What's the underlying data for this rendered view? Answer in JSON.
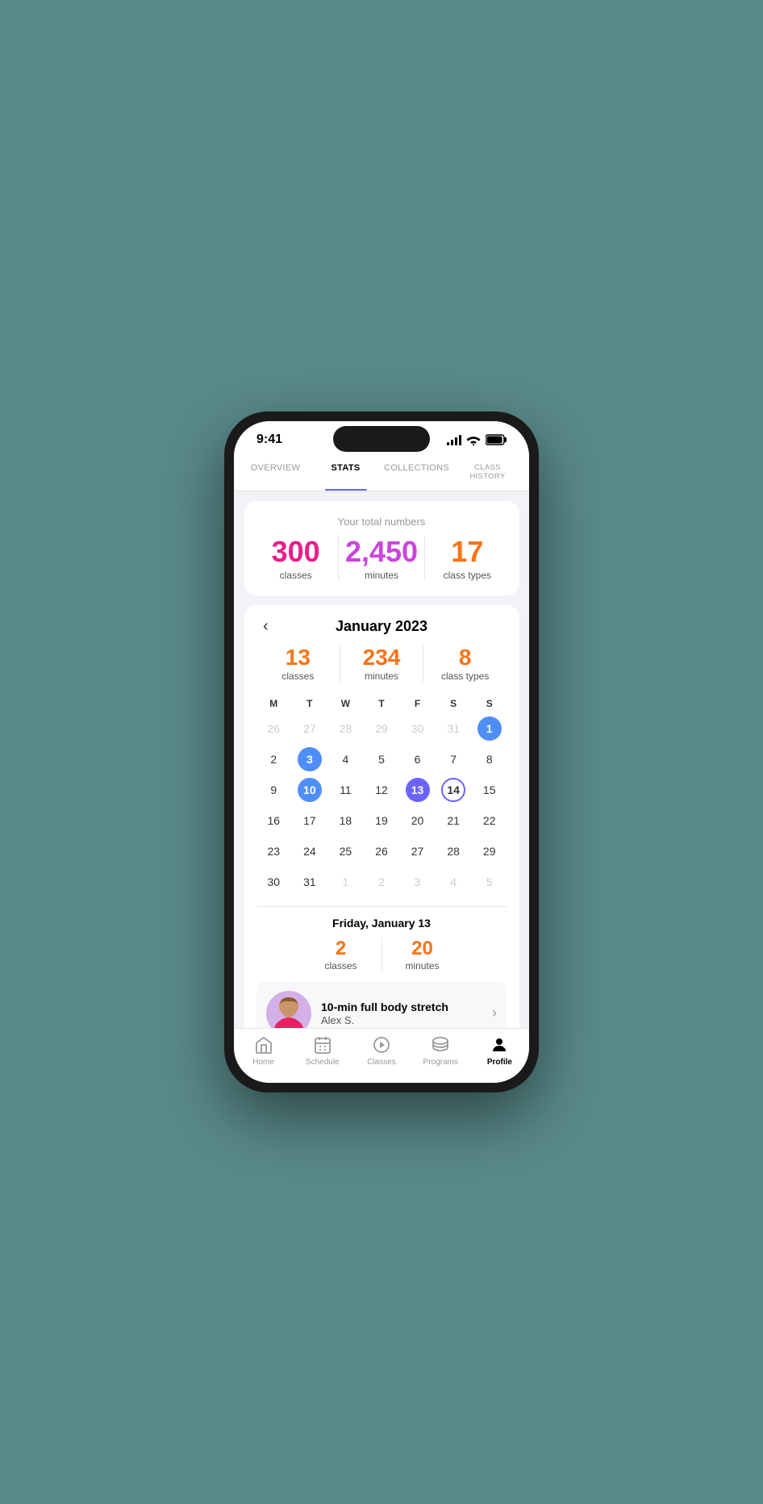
{
  "statusBar": {
    "time": "9:41",
    "signalBars": [
      3,
      6,
      9,
      12
    ],
    "wifiLabel": "wifi",
    "batteryLabel": "battery"
  },
  "tabs": [
    {
      "id": "overview",
      "label": "OVERVIEW",
      "active": false
    },
    {
      "id": "stats",
      "label": "STATS",
      "active": true
    },
    {
      "id": "collections",
      "label": "COLLECTIONS",
      "active": false
    },
    {
      "id": "class-history",
      "label": "CLASS HISTORY",
      "active": false
    }
  ],
  "totalStats": {
    "subtitle": "Your total numbers",
    "classes": {
      "value": "300",
      "label": "classes"
    },
    "minutes": {
      "value": "2,450",
      "label": "minutes"
    },
    "classTypes": {
      "value": "17",
      "label": "class types"
    },
    "classesColor": "#e91e8c",
    "minutesColor": "#cc44dd",
    "classTypesColor": "#f97316"
  },
  "calendar": {
    "backLabel": "‹",
    "title": "January 2023",
    "monthStats": {
      "classes": {
        "value": "13",
        "label": "classes"
      },
      "minutes": {
        "value": "234",
        "label": "minutes"
      },
      "classTypes": {
        "value": "8",
        "label": "class types"
      }
    },
    "dayHeaders": [
      "M",
      "T",
      "W",
      "T",
      "F",
      "S",
      "S"
    ],
    "weeks": [
      [
        {
          "day": "26",
          "muted": true
        },
        {
          "day": "27",
          "muted": true
        },
        {
          "day": "28",
          "muted": true
        },
        {
          "day": "29",
          "muted": true
        },
        {
          "day": "30",
          "muted": true
        },
        {
          "day": "31",
          "muted": true
        },
        {
          "day": "1",
          "highlight": "blue-filled"
        }
      ],
      [
        {
          "day": "2"
        },
        {
          "day": "3",
          "highlight": "blue-filled"
        },
        {
          "day": "4"
        },
        {
          "day": "5"
        },
        {
          "day": "6"
        },
        {
          "day": "7"
        },
        {
          "day": "8"
        }
      ],
      [
        {
          "day": "9"
        },
        {
          "day": "10",
          "highlight": "blue-filled"
        },
        {
          "day": "11"
        },
        {
          "day": "12"
        },
        {
          "day": "13",
          "highlight": "purple-filled"
        },
        {
          "day": "14",
          "highlight": "purple-outline"
        },
        {
          "day": "15"
        }
      ],
      [
        {
          "day": "16"
        },
        {
          "day": "17"
        },
        {
          "day": "18"
        },
        {
          "day": "19"
        },
        {
          "day": "20"
        },
        {
          "day": "21"
        },
        {
          "day": "22"
        }
      ],
      [
        {
          "day": "23"
        },
        {
          "day": "24"
        },
        {
          "day": "25"
        },
        {
          "day": "26"
        },
        {
          "day": "27"
        },
        {
          "day": "28"
        },
        {
          "day": "29"
        }
      ],
      [
        {
          "day": "30"
        },
        {
          "day": "31"
        },
        {
          "day": "1",
          "muted": true
        },
        {
          "day": "2",
          "muted": true
        },
        {
          "day": "3",
          "muted": true
        },
        {
          "day": "4",
          "muted": true
        },
        {
          "day": "5",
          "muted": true
        }
      ]
    ],
    "selectedDay": {
      "title": "Friday, January 13",
      "classes": {
        "value": "2",
        "label": "classes"
      },
      "minutes": {
        "value": "20",
        "label": "minutes"
      }
    },
    "classes": [
      {
        "name": "10-min full body stretch",
        "instructor": "Alex S.",
        "hasAvatar": true
      },
      {
        "name": "",
        "instructor": "",
        "hasAvatar": true
      }
    ]
  },
  "bottomNav": [
    {
      "id": "home",
      "label": "Home",
      "icon": "home",
      "active": false
    },
    {
      "id": "schedule",
      "label": "Schedule",
      "icon": "schedule",
      "active": false
    },
    {
      "id": "classes",
      "label": "Classes",
      "icon": "classes",
      "active": false
    },
    {
      "id": "programs",
      "label": "Programs",
      "icon": "programs",
      "active": false
    },
    {
      "id": "profile",
      "label": "Profile",
      "icon": "profile",
      "active": true
    }
  ]
}
